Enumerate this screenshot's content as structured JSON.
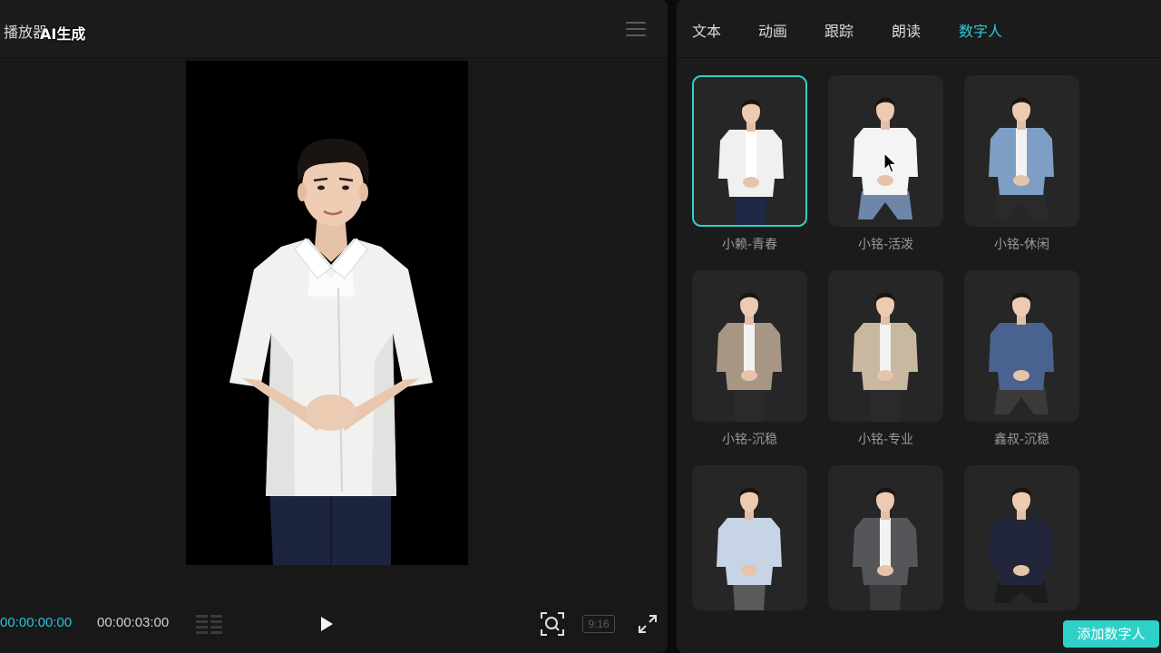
{
  "player": {
    "title": "播放器",
    "ai_badge": "AI生成",
    "time_current": "00:00:00:00",
    "time_total": "00:00:03:00",
    "ratio": "9:16"
  },
  "panel": {
    "tabs": [
      {
        "label": "文本",
        "active": false
      },
      {
        "label": "动画",
        "active": false
      },
      {
        "label": "跟踪",
        "active": false
      },
      {
        "label": "朗读",
        "active": false
      },
      {
        "label": "数字人",
        "active": true
      }
    ],
    "avatars": [
      {
        "label": "小赖-青春",
        "selected": true
      },
      {
        "label": "小铭-活泼",
        "selected": false
      },
      {
        "label": "小铭-休闲",
        "selected": false
      },
      {
        "label": "小铭-沉稳",
        "selected": false
      },
      {
        "label": "小铭-专业",
        "selected": false
      },
      {
        "label": "鑫叔-沉稳",
        "selected": false
      },
      {
        "label": "",
        "selected": false
      },
      {
        "label": "",
        "selected": false
      },
      {
        "label": "",
        "selected": false
      }
    ],
    "add_button": "添加数字人"
  },
  "colors": {
    "accent": "#2fd0c8",
    "time_accent": "#29c4d4",
    "panel_bg": "#1b1b1c",
    "player_bg": "#181818"
  }
}
